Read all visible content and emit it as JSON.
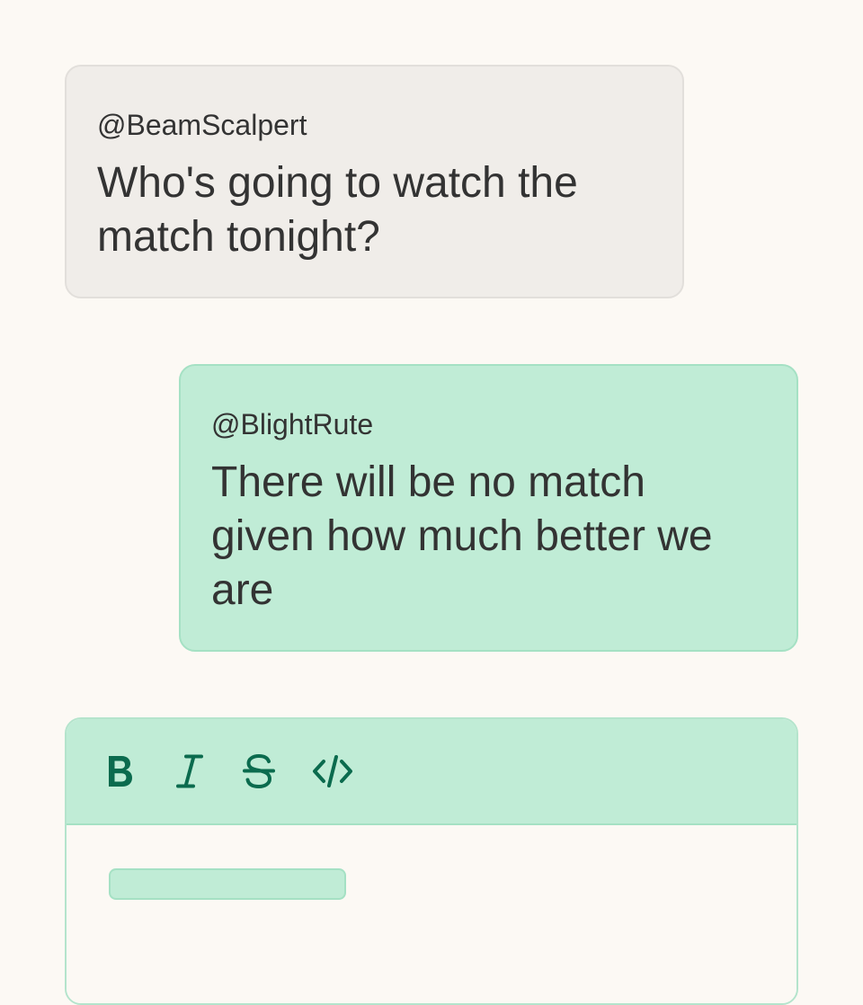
{
  "messages": [
    {
      "author": "@BeamScalpert",
      "text": "Who's going to watch the match tonight?"
    },
    {
      "author": "@BlightRute",
      "text": "There will be no match given how much better we are"
    }
  ],
  "toolbar": {
    "tools": [
      {
        "name": "bold",
        "icon": "bold-icon"
      },
      {
        "name": "italic",
        "icon": "italic-icon"
      },
      {
        "name": "strikethrough",
        "icon": "strikethrough-icon"
      },
      {
        "name": "code",
        "icon": "code-icon"
      }
    ]
  },
  "colors": {
    "background": "#fcf9f4",
    "incoming_bubble": "#f0ede9",
    "outgoing_bubble": "#c0ecd6",
    "accent": "#0b6b4e",
    "text": "#333333"
  }
}
